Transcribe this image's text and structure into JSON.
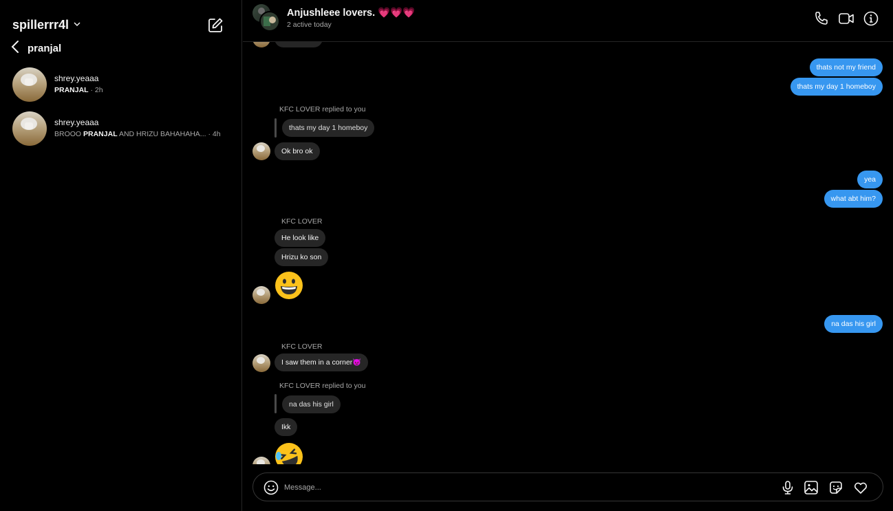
{
  "sidebar": {
    "account_name": "spillerrr4l",
    "back_title": "pranjal",
    "threads": [
      {
        "name": "shrey.yeaaa",
        "preview_bold": "PRANJAL",
        "preview_pre": "",
        "preview_post": "",
        "time": " · 2h"
      },
      {
        "name": "shrey.yeaaa",
        "preview_pre": "BROOO ",
        "preview_bold": "PRANJAL",
        "preview_post": " AND HRIZU BAHAHAHA...",
        "time": " · 4h"
      }
    ]
  },
  "header": {
    "title": "Anjushleee lovers. 💗💗💗",
    "subtitle": "2 active today"
  },
  "messages": {
    "m1": "thats not my friend",
    "m2": "thats my day 1 homeboy",
    "reply1_caption": "KFC LOVER replied to you",
    "reply1_quote": "thats my day 1 homeboy",
    "m3": "Ok bro ok",
    "m4": "yea",
    "m5": "what abt him?",
    "sender1": "KFC LOVER",
    "m6": "He look like",
    "m7": "Hrizu ko son",
    "m8_emoji": "😀",
    "m9": "na das his girl",
    "sender2": "KFC LOVER",
    "m10": "I saw them in a corner😈",
    "reply2_caption": "KFC LOVER replied to you",
    "reply2_quote": "na das his girl",
    "m11": "Ikk",
    "m12_emoji": "🤣"
  },
  "composer": {
    "placeholder": "Message..."
  },
  "icons": {
    "account_dropdown": "chevron-down-icon",
    "compose": "new-message-icon",
    "back": "chevron-left-icon",
    "call": "phone-icon",
    "video": "video-icon",
    "info": "info-icon",
    "emoji": "smiley-icon",
    "mic": "microphone-icon",
    "image": "image-icon",
    "sticker": "sticker-icon",
    "like": "heart-icon"
  },
  "colors": {
    "background": "#000000",
    "outgoing_bubble": "#3797f0",
    "incoming_bubble": "#262626",
    "muted_text": "#a8a8a8"
  }
}
